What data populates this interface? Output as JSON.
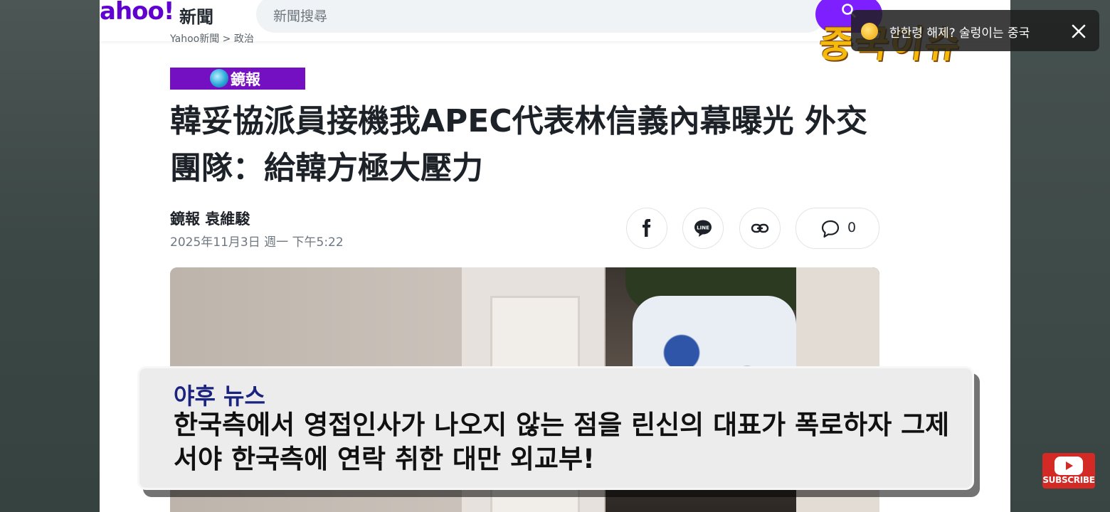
{
  "yahoo": {
    "logo_text": "ahoo!",
    "logo_sub": "新聞",
    "search_placeholder": "新聞搜尋",
    "breadcrumb": "Yahoo新聞 > 政治"
  },
  "article": {
    "source": "鏡報",
    "headline": "韓妥協派員接機我APEC代表林信義內幕曝光 外交團隊：給韓方極大壓力",
    "byline": "鏡報 袁維駿",
    "published": "2025年11月3日 週一 下午5:22",
    "comment_count": "0"
  },
  "subtitle": {
    "source": "야후 뉴스",
    "text": "한국측에서 영접인사가 나오지 않는 점을 린신의 대표가 폭로하자 그제서야 한국측에 연락 취한 대만 외교부!"
  },
  "notification": {
    "text": "한한령 해제? 술렁이는 중국"
  },
  "channel": {
    "logo_text": "중국이슈",
    "subscribe_label": "SUBSCRIBE"
  },
  "colors": {
    "yahoo_purple": "#6001d2",
    "search_button": "#7e1fff",
    "source_badge": "#7510c2",
    "subscribe_red": "#d32a25"
  }
}
